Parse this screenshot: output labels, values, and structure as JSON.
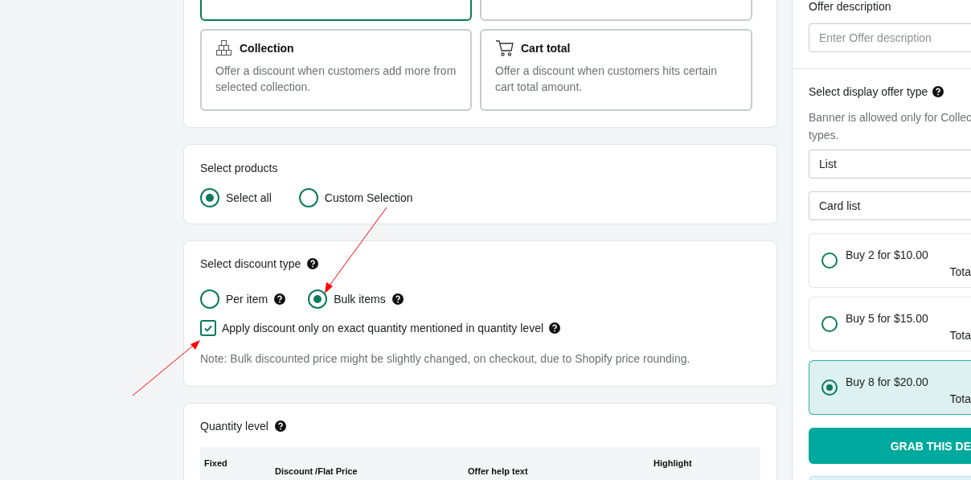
{
  "offer_types": [
    {
      "selected": true
    },
    {
      "selected": false
    },
    {
      "kind": "collection",
      "title": "Collection",
      "description": "Offer a discount when customers add more from selected collection.",
      "selected": false
    },
    {
      "kind": "cart",
      "title": "Cart total",
      "description": "Offer a discount when customers hits certain cart total amount.",
      "selected": false
    }
  ],
  "select_products": {
    "title": "Select products",
    "options": [
      {
        "label": "Select all",
        "selected": true
      },
      {
        "label": "Custom Selection",
        "selected": false
      }
    ]
  },
  "discount_type": {
    "title": "Select discount type",
    "options": [
      {
        "label": "Per item",
        "selected": false
      },
      {
        "label": "Bulk items",
        "selected": true
      }
    ],
    "exact_quantity": {
      "label": "Apply discount only on exact quantity mentioned in quantity level",
      "checked": true
    },
    "note": "Note: Bulk discounted price might be slightly changed, on checkout, due to Shopify price rounding."
  },
  "quantity_level": {
    "title": "Quantity level",
    "columns": [
      "Fixed",
      "Discount /Flat Price",
      "Offer help text",
      "Highlight"
    ]
  },
  "side_panel": {
    "description_label": "Offer description",
    "description_placeholder": "Enter Offer description",
    "display_title": "Select display offer type",
    "note_lines": [
      "Banner is allowed only for Collec",
      "types."
    ],
    "selects": [
      "List",
      "Card list"
    ],
    "offers": [
      {
        "label": "Buy 2 for $10.00",
        "total": "Tota",
        "selected": false
      },
      {
        "label": "Buy 5 for $15.00",
        "total": "Tota",
        "selected": false
      },
      {
        "label": "Buy 8 for $20.00",
        "total": "Tota",
        "selected": true
      }
    ],
    "button": "GRAB THIS DE"
  }
}
